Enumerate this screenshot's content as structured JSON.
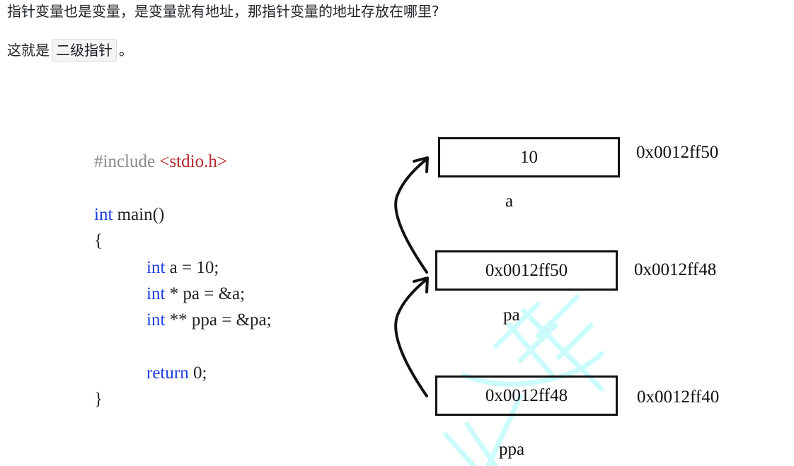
{
  "paragraphs": {
    "p1": "指针变量也是变量，是变量就有地址，那指针变量的地址存放在哪里?",
    "p2_prefix": "这就是",
    "p2_code": "二级指针",
    "p2_suffix": "。"
  },
  "code": {
    "include_directive": "#include",
    "include_header": "<stdio.h>",
    "main_kw": "int",
    "main_rest": " main()",
    "open_brace": "{",
    "lines": [
      {
        "kw": "int",
        "rest": " a = 10;"
      },
      {
        "kw": "int",
        "rest": " * pa = &a;"
      },
      {
        "kw": "int",
        "rest": " ** ppa = &pa;"
      }
    ],
    "return_kw": "return",
    "return_rest": " 0;",
    "close_brace": "}"
  },
  "memory_diagram": {
    "cells": [
      {
        "value": "10",
        "name": "a",
        "address": "0x0012ff50"
      },
      {
        "value": "0x0012ff50",
        "name": "pa",
        "address": "0x0012ff48"
      },
      {
        "value": "0x0012ff48",
        "name": "ppa",
        "address": "0x0012ff40"
      }
    ],
    "arrows": [
      {
        "from": "pa",
        "to": "a"
      },
      {
        "from": "ppa",
        "to": "pa"
      }
    ]
  },
  "colors": {
    "keyword": "#1a3de0",
    "preprocessor": "#8a8a8a",
    "include_header": "#b5272d",
    "watermark": "#ccfbfb"
  }
}
